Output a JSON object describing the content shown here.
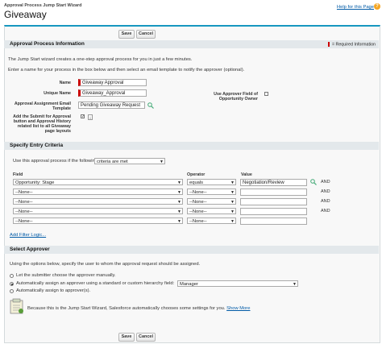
{
  "header": {
    "breadcrumb": "Approval Process Jump Start Wizard",
    "title": "Giveaway",
    "help_link": "Help for this Page",
    "help_icon": "?"
  },
  "buttons": {
    "save": "Save",
    "cancel": "Cancel"
  },
  "section1": {
    "title": "Approval Process Information",
    "required_legend": "= Required Information",
    "intro1": "The Jump Start wizard creates a one-step approval process for you in just a few minutes.",
    "intro2": "Enter a name for your process in the box below and then select an email template to notify the approver (optional).",
    "name_label": "Name",
    "name_value": "Giveaway Approval",
    "unique_label": "Unique Name",
    "unique_value": "Giveaway_Approval",
    "email_label": "Approval Assignment Email Template",
    "email_value": "Pending Giveaway Request",
    "add_submit_label": "Add the Submit for Approval button and Approval History related list to all Giveaway page layouts",
    "add_submit_checked": "✓",
    "use_approver_label": "Use Approver Field of Opportunity Owner",
    "info": "i"
  },
  "section2": {
    "title": "Specify Entry Criteria",
    "intro": "Use this approval process if the following",
    "mode": "criteria are met",
    "col_field": "Field",
    "col_operator": "Operator",
    "col_value": "Value",
    "rows": [
      {
        "field": "Opportunity: Stage",
        "operator": "equals",
        "value": "Negotiation/Review",
        "and": "AND"
      },
      {
        "field": "--None--",
        "operator": "--None--",
        "value": "",
        "and": "AND"
      },
      {
        "field": "--None--",
        "operator": "--None--",
        "value": "",
        "and": "AND"
      },
      {
        "field": "--None--",
        "operator": "--None--",
        "value": "",
        "and": "AND"
      },
      {
        "field": "--None--",
        "operator": "--None--",
        "value": "",
        "and": ""
      }
    ],
    "filter_link": "Add Filter Logic..."
  },
  "section3": {
    "title": "Select Approver",
    "intro": "Using the options below, specify the user to whom the approval request should be assigned.",
    "opt1": "Let the submitter choose the approver manually.",
    "opt2": "Automatically assign an approver using a standard or custom hierarchy field:",
    "opt2_value": "Manager",
    "opt3": "Automatically assign to approver(s).",
    "note": "Because this is the Jump Start Wizard, Salesforce automatically chooses some settings for you.",
    "show_more": "Show More"
  },
  "colors": {
    "accent": "#1797c0",
    "required": "#cc0000",
    "link": "#015ba7"
  }
}
